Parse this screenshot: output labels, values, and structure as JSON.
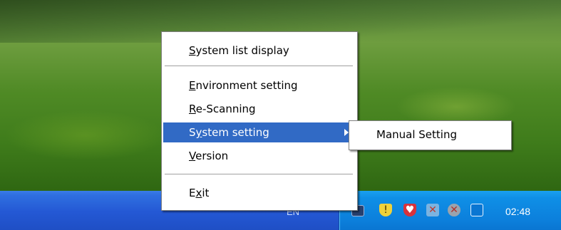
{
  "taskbar": {
    "language": "EN",
    "clock": "02:48",
    "tray_icons": [
      "monitor-icon",
      "security-shield-icon",
      "antivirus-shield-icon",
      "network-error-icon",
      "messenger-icon",
      "window-icon"
    ]
  },
  "menu": {
    "items": [
      {
        "pre": "",
        "acc": "S",
        "post": "ystem list display"
      },
      {
        "pre": "",
        "acc": "E",
        "post": "nvironment setting"
      },
      {
        "pre": "",
        "acc": "R",
        "post": "e-Scanning"
      },
      {
        "pre": "S",
        "acc": "y",
        "post": "stem setting"
      },
      {
        "pre": "",
        "acc": "V",
        "post": "ersion"
      },
      {
        "pre": "E",
        "acc": "x",
        "post": "it"
      }
    ],
    "highlight_color": "#316ac5"
  },
  "submenu": {
    "items": [
      {
        "label": "Manual Setting"
      }
    ]
  }
}
